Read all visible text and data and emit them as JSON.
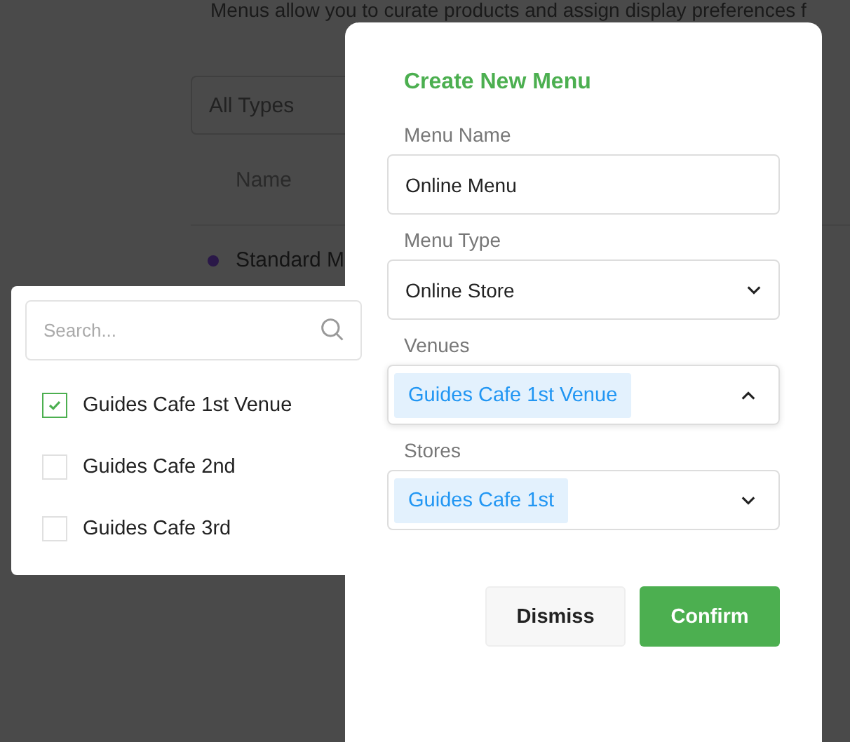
{
  "page": {
    "description": "Menus allow you to curate products and assign display preferences f",
    "type_filter": "All Types",
    "table": {
      "columns": [
        "Name"
      ],
      "rows": [
        {
          "name": "Standard M"
        }
      ]
    }
  },
  "dialog": {
    "title": "Create New Menu",
    "fields": [
      {
        "kind": "text",
        "label": "Menu Name",
        "value": "Online Menu"
      },
      {
        "kind": "select",
        "label": "Menu Type",
        "value": "Online Store",
        "expanded": false
      },
      {
        "kind": "multiselect",
        "label": "Venues",
        "tags": [
          "Guides Cafe 1st Venue"
        ],
        "expanded": true
      },
      {
        "kind": "multiselect",
        "label": "Stores",
        "tags": [
          "Guides Cafe 1st"
        ],
        "expanded": false
      }
    ],
    "buttons": [
      {
        "label": "Dismiss",
        "kind": "secondary"
      },
      {
        "label": "Confirm",
        "kind": "primary"
      }
    ]
  },
  "venue_dropdown": {
    "search": {
      "placeholder": "Search..."
    },
    "options": [
      {
        "label": "Guides Cafe 1st Venue",
        "checked": true
      },
      {
        "label": "Guides Cafe 2nd",
        "checked": false
      },
      {
        "label": "Guides Cafe 3rd",
        "checked": false
      }
    ]
  }
}
